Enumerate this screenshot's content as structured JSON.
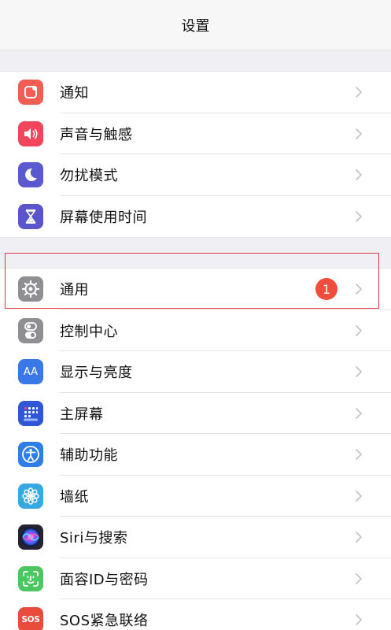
{
  "nav": {
    "title": "设置"
  },
  "group1": [
    {
      "label": "通知",
      "icon": "notification-icon",
      "color": "#f25e51"
    },
    {
      "label": "声音与触感",
      "icon": "speaker-icon",
      "color": "#f2465c"
    },
    {
      "label": "勿扰模式",
      "icon": "moon-icon",
      "color": "#5a59cf"
    },
    {
      "label": "屏幕使用时间",
      "icon": "hourglass-icon",
      "color": "#5a56c9"
    }
  ],
  "group2": [
    {
      "label": "通用",
      "icon": "gear-icon",
      "color": "#8e8e93",
      "badge": "1"
    },
    {
      "label": "控制中心",
      "icon": "toggles-icon",
      "color": "#8e8e93"
    },
    {
      "label": "显示与亮度",
      "icon": "text-size-icon",
      "color": "#3a78e8",
      "icon_text": "AA"
    },
    {
      "label": "主屏幕",
      "icon": "home-grid-icon",
      "color": "#2f56d8"
    },
    {
      "label": "辅助功能",
      "icon": "accessibility-icon",
      "color": "#2d7ee6"
    },
    {
      "label": "墙纸",
      "icon": "flower-icon",
      "color": "#37a8e0"
    },
    {
      "label": "Siri与搜索",
      "icon": "siri-icon",
      "color": "#222233"
    },
    {
      "label": "面容ID与密码",
      "icon": "face-id-icon",
      "color": "#4cc75f"
    },
    {
      "label": "SOS紧急联络",
      "icon": "sos-icon",
      "color": "#e94b3c",
      "icon_text": "SOS"
    }
  ],
  "colors": {
    "badge": "#ee4e3b",
    "highlight": "#d9393e",
    "chevron": "#c4c4c8"
  }
}
